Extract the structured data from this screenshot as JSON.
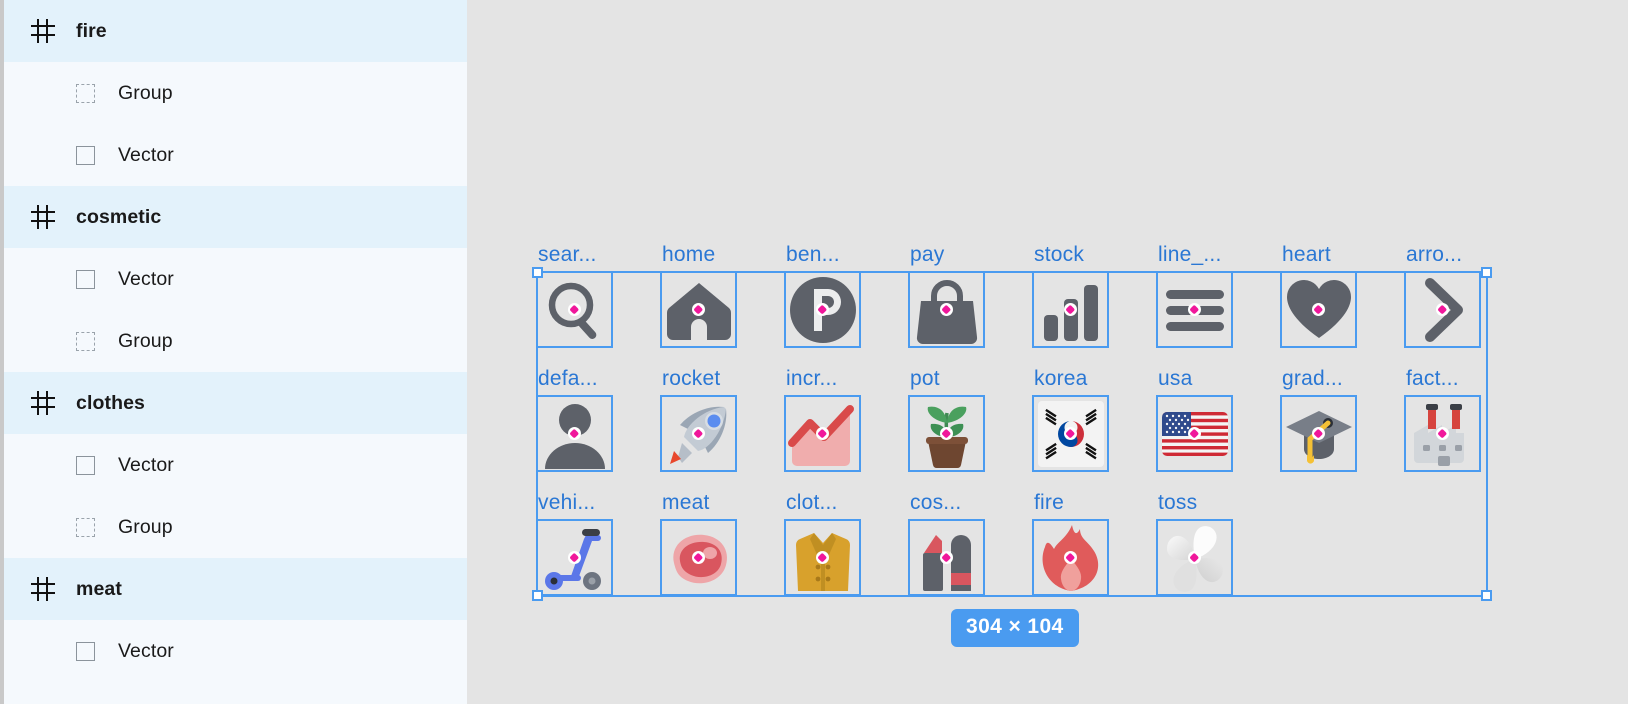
{
  "sidebar": {
    "layers": [
      {
        "type": "section",
        "icon": "frame-hash-icon",
        "label": "fire"
      },
      {
        "type": "child",
        "icon": "group-icon",
        "label": "Group"
      },
      {
        "type": "child",
        "icon": "vector-icon",
        "label": "Vector"
      },
      {
        "type": "section",
        "icon": "frame-hash-icon",
        "label": "cosmetic"
      },
      {
        "type": "child",
        "icon": "vector-icon",
        "label": "Vector"
      },
      {
        "type": "child",
        "icon": "group-icon",
        "label": "Group"
      },
      {
        "type": "section",
        "icon": "frame-hash-icon",
        "label": "clothes"
      },
      {
        "type": "child",
        "icon": "vector-icon",
        "label": "Vector"
      },
      {
        "type": "child",
        "icon": "group-icon",
        "label": "Group"
      },
      {
        "type": "section",
        "icon": "frame-hash-icon",
        "label": "meat"
      },
      {
        "type": "child",
        "icon": "vector-icon",
        "label": "Vector"
      }
    ]
  },
  "canvas": {
    "selection": {
      "dimension_badge": "304 × 104",
      "accent_color": "#4a9bf0",
      "handle_fill": "#ffffff",
      "anchor_color": "#f0179b"
    },
    "background_color": "#e4e4e4",
    "rows": [
      {
        "cells": [
          {
            "label": "sear...",
            "icon": "magnifier-icon"
          },
          {
            "label": "home",
            "icon": "house-icon"
          },
          {
            "label": "ben...",
            "icon": "parking-circle-icon"
          },
          {
            "label": "pay",
            "icon": "handbag-icon"
          },
          {
            "label": "stock",
            "icon": "bar-chart-icon"
          },
          {
            "label": "line_...",
            "icon": "list-lines-icon"
          },
          {
            "label": "heart",
            "icon": "heart-icon"
          },
          {
            "label": "arro...",
            "icon": "chevron-right-icon"
          }
        ]
      },
      {
        "cells": [
          {
            "label": "defa...",
            "icon": "person-avatar-icon"
          },
          {
            "label": "rocket",
            "icon": "rocket-icon"
          },
          {
            "label": "incr...",
            "icon": "area-chart-icon"
          },
          {
            "label": "pot",
            "icon": "potted-plant-icon"
          },
          {
            "label": "korea",
            "icon": "korea-flag-icon"
          },
          {
            "label": "usa",
            "icon": "usa-flag-icon"
          },
          {
            "label": "grad...",
            "icon": "graduation-cap-icon"
          },
          {
            "label": "fact...",
            "icon": "factory-icon"
          }
        ]
      },
      {
        "cells": [
          {
            "label": "vehi...",
            "icon": "scooter-icon"
          },
          {
            "label": "meat",
            "icon": "steak-icon"
          },
          {
            "label": "clot...",
            "icon": "coat-icon"
          },
          {
            "label": "cos...",
            "icon": "lipstick-icon"
          },
          {
            "label": "fire",
            "icon": "flame-icon"
          },
          {
            "label": "toss",
            "icon": "pinwheel-icon"
          }
        ]
      }
    ]
  }
}
